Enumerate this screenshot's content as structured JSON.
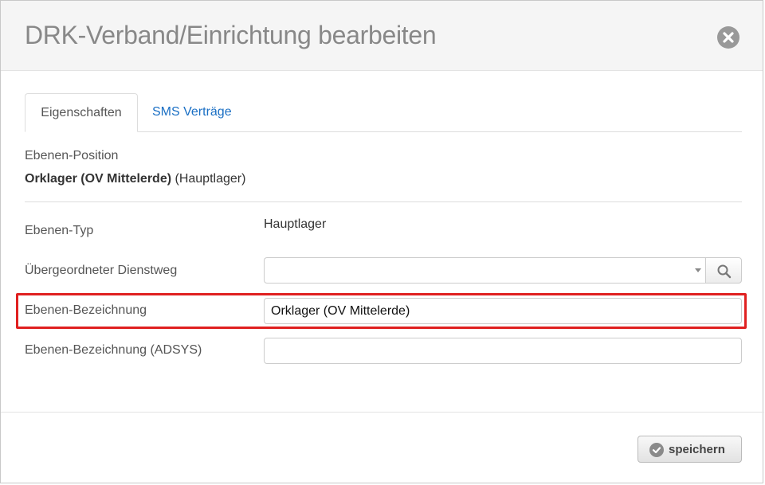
{
  "dialog": {
    "title": "DRK-Verband/Einrichtung bearbeiten"
  },
  "tabs": [
    {
      "label": "Eigenschaften",
      "active": true
    },
    {
      "label": "SMS Verträge",
      "active": false
    }
  ],
  "position": {
    "label": "Ebenen-Position",
    "name_bold": "Orklager (OV Mittelerde)",
    "suffix": " (Hauptlager)"
  },
  "fields": {
    "type": {
      "label": "Ebenen-Typ",
      "value": "Hauptlager"
    },
    "parent": {
      "label": "Übergeordneter Dienstweg",
      "value": ""
    },
    "name": {
      "label": "Ebenen-Bezeichnung",
      "value": "Orklager (OV Mittelerde)"
    },
    "adsys": {
      "label": "Ebenen-Bezeichnung (ADSYS)",
      "value": ""
    }
  },
  "footer": {
    "save_label": "speichern"
  },
  "icons": {
    "close": "close-icon",
    "search": "search-icon",
    "check": "check-icon",
    "caret": "chevron-down-icon"
  },
  "colors": {
    "highlight": "#e02020",
    "link": "#1a6fc4"
  }
}
